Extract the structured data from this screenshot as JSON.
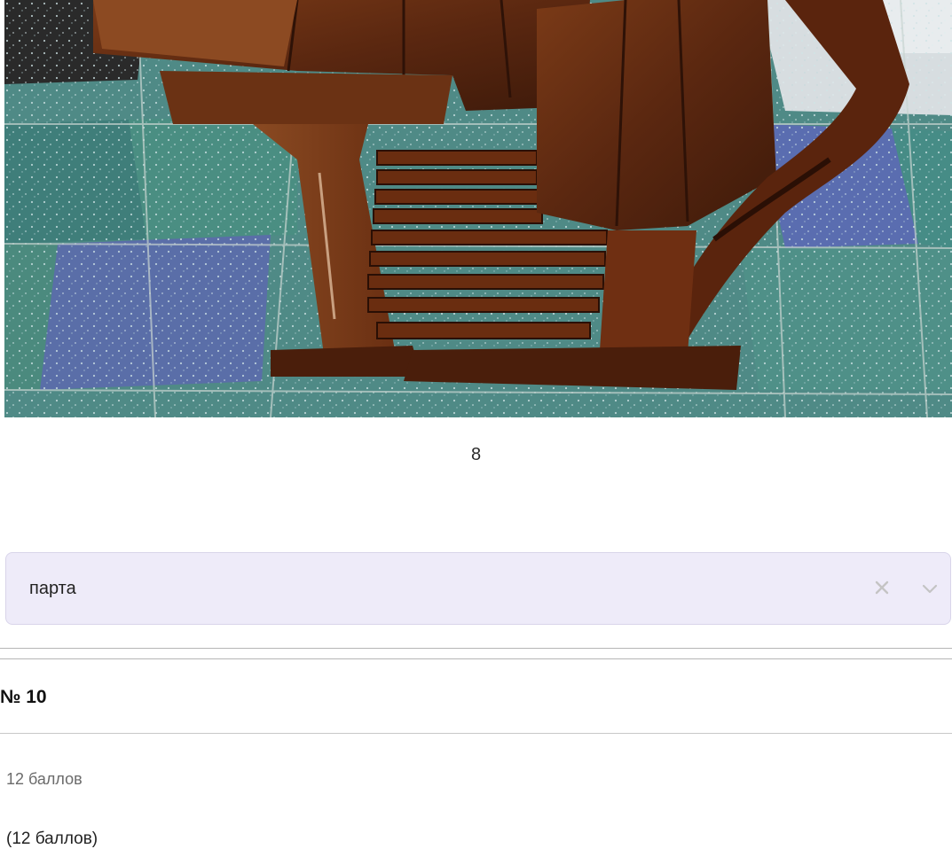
{
  "photo": {
    "alt_icon": "school-desk-photo"
  },
  "caption": "8",
  "answer_select": {
    "value": "парта",
    "clear_icon": "close-icon",
    "dropdown_icon": "chevron-down-icon"
  },
  "question": {
    "title": "№ 10",
    "points": "12 баллов",
    "points_bottom": "(12 баллов)"
  },
  "colors": {
    "select_bg": "#eeebf9",
    "select_border": "#d9d5ea"
  }
}
